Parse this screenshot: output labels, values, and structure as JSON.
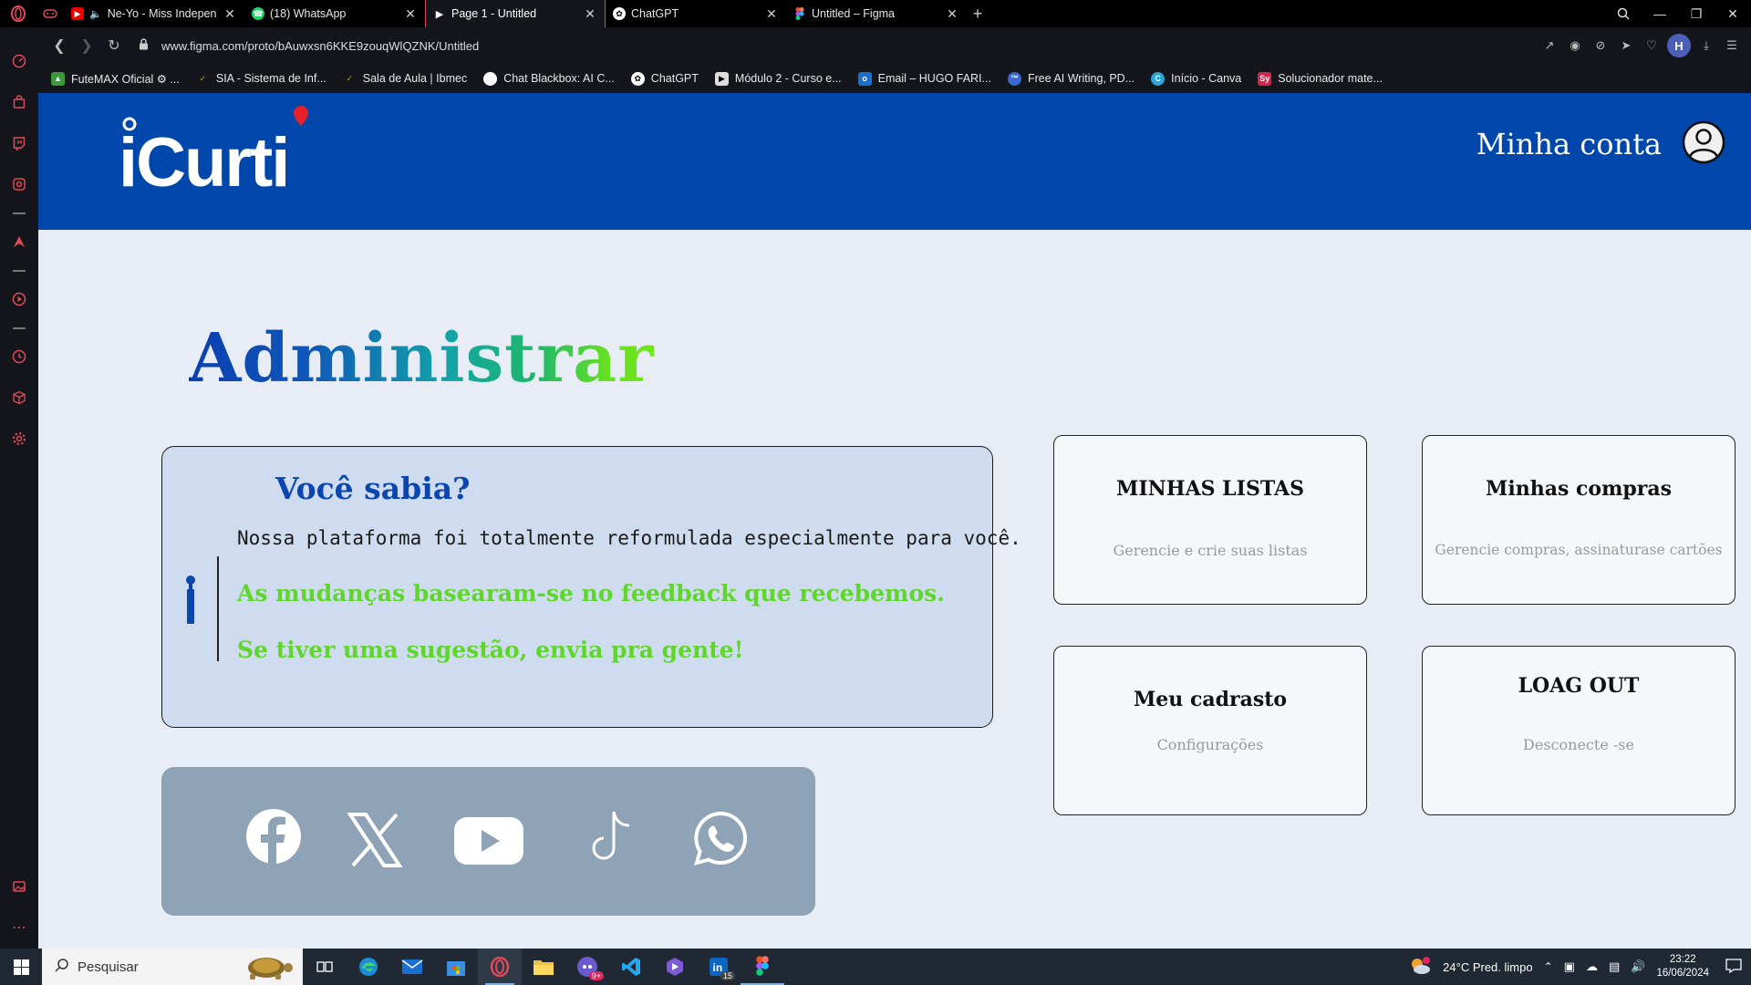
{
  "browser": {
    "tabs": [
      {
        "label": "Ne-Yo - Miss Independ",
        "favicon": "youtube-icon",
        "muted": true
      },
      {
        "label": "(18) WhatsApp",
        "favicon": "whatsapp-icon"
      },
      {
        "label": "Page 1 - Untitled",
        "favicon": "play-icon",
        "active": true
      },
      {
        "label": "ChatGPT",
        "favicon": "chatgpt-icon"
      },
      {
        "label": "Untitled – Figma",
        "favicon": "figma-icon"
      }
    ],
    "url": "www.figma.com/proto/bAuwxsn6KKE9zouqWlQZNK/Untitled",
    "profile_initial": "H",
    "bookmarks": [
      {
        "label": "FuteMAX Oficial ⚙ ...",
        "color": "#3a9a3a"
      },
      {
        "label": "SIA - Sistema de Inf...",
        "color": "#caa21e"
      },
      {
        "label": "Sala de Aula | Ibmec",
        "color": "#caa21e"
      },
      {
        "label": "Chat Blackbox: AI C...",
        "color": "#ffffff"
      },
      {
        "label": "ChatGPT",
        "color": "#666666"
      },
      {
        "label": "Módulo 2 - Curso e...",
        "color": "#dddddd"
      },
      {
        "label": "Email – HUGO FARI...",
        "color": "#1a6fd0"
      },
      {
        "label": "Free AI Writing, PD...",
        "color": "#3a6ad0"
      },
      {
        "label": "Início - Canva",
        "color": "#2aa4d8"
      },
      {
        "label": "Solucionador mate...",
        "color": "#d8224a"
      }
    ]
  },
  "site": {
    "logo_text": "iCurti",
    "account_label": "Minha conta",
    "title": "Administrar",
    "info": {
      "title": "Você sabia?",
      "line1": "Nossa plataforma foi totalmente reformulada especialmente para você.",
      "line2": "As mudanças basearam-se no feedback que recebemos.",
      "line3": "Se tiver uma sugestão, envia pra gente!"
    },
    "social": [
      "facebook-icon",
      "x-icon",
      "youtube-icon",
      "tiktok-icon",
      "whatsapp-icon"
    ],
    "cards": [
      {
        "title": "MINHAS  LISTAS",
        "subtitle": "Gerencie e crie suas listas"
      },
      {
        "title": "Minhas compras",
        "subtitle": "Gerencie compras, assinaturase cartões"
      },
      {
        "title": "Meu cadrasto",
        "subtitle": "Configurações"
      },
      {
        "title": "LOAG OUT",
        "subtitle": "Desconecte -se"
      }
    ],
    "colors": {
      "header": "#0047ab",
      "accent_green": "#5ed62a",
      "brand_blue": "#0a46ae"
    }
  },
  "taskbar": {
    "search_placeholder": "Pesquisar",
    "weather": "24°C  Pred. limpo",
    "time": "23:22",
    "date": "16/06/2024",
    "linkedin_badge": "15",
    "discord_badge": "9+"
  }
}
